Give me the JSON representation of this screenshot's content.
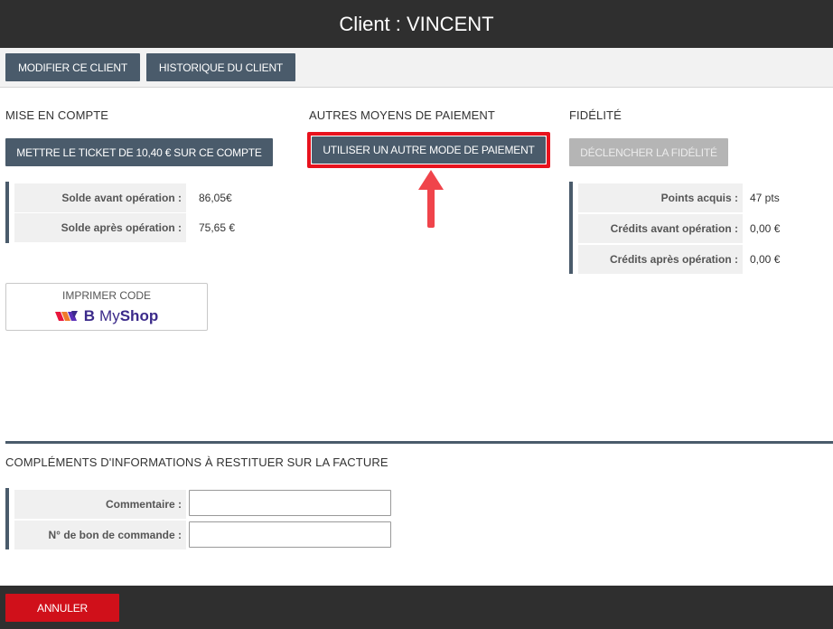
{
  "header": {
    "title": "Client : VINCENT"
  },
  "toolbar": {
    "edit_client_label": "Modifier ce client",
    "client_history_label": "Historique du client"
  },
  "account": {
    "section_title": "Mise en compte",
    "put_ticket_label": "Mettre le ticket de 10,40 € sur ce compte",
    "rows": [
      {
        "label": "Solde avant opération :",
        "value": "86,05€"
      },
      {
        "label": "Solde après opération :",
        "value": "75,65 €"
      }
    ]
  },
  "other_payment": {
    "section_title": "Autres moyens de paiement",
    "use_other_label": "Utiliser un autre mode de paiement"
  },
  "loyalty": {
    "section_title": "Fidélité",
    "trigger_label": "Déclencher la fidélité",
    "rows": [
      {
        "label": "Points acquis :",
        "value": "47 pts"
      },
      {
        "label": "Crédits avant opération :",
        "value": "0,00 €"
      },
      {
        "label": "Crédits après opération :",
        "value": "0,00 €"
      }
    ]
  },
  "print_code": {
    "label": "Imprimer code",
    "brand_b": "B",
    "brand_my": "My",
    "brand_shop": "Shop"
  },
  "invoice_info": {
    "section_title": "Compléments d'informations à restituer sur la facture",
    "comment_label": "Commentaire :",
    "comment_value": "",
    "order_label": "N° de bon de commande :",
    "order_value": ""
  },
  "footer": {
    "cancel_label": "Annuler"
  },
  "colors": {
    "accent": "#4a5b6b",
    "highlight": "#e8121d",
    "cancel": "#d0101a",
    "brand": "#3b2a8a"
  }
}
